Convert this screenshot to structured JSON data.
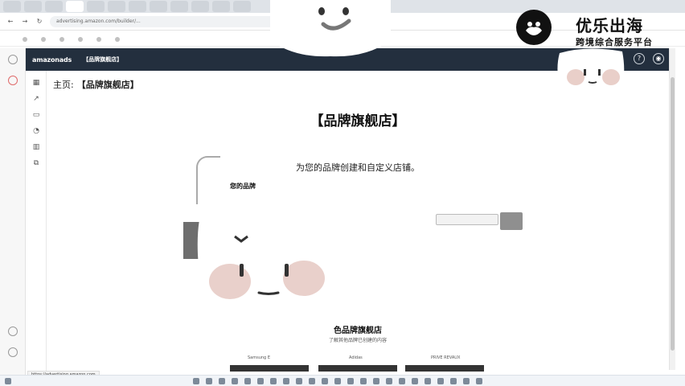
{
  "browser": {
    "tabs": [
      "",
      "",
      "",
      "",
      "",
      "",
      "",
      "",
      "",
      "",
      "",
      ""
    ],
    "url": "advertising.amazon.com/builder/...",
    "bookmarks": [
      "",
      "",
      "",
      "",
      "",
      "",
      ""
    ]
  },
  "leftrail": {
    "top_label": "",
    "bottom_label": ""
  },
  "ads_header": {
    "logo": "amazonads",
    "store_name": "【品牌旗舰店】",
    "help_icon": "?",
    "user_icon": "◉"
  },
  "breadcrumb": {
    "home": "主页:",
    "store": "【品牌旗舰店】"
  },
  "content": {
    "title": "【品牌旗舰店】",
    "subtitle": "为您的品牌创建和自定义店铺。",
    "brand_heading": "您的品牌",
    "brand_desc": "",
    "create_button": "",
    "manage_link": ""
  },
  "stores_section": {
    "heading": "色品牌旗舰店",
    "sub": "了解其他品牌已创建的内容",
    "cards": [
      "Samsung E",
      "Adidas",
      "PRIVE REVAUX"
    ]
  },
  "status_url": "https://advertising.amazon.com",
  "taskbar": {
    "time": ""
  },
  "watermark": {
    "title": "优乐出海",
    "subtitle": "跨境综合服务平台"
  },
  "colors": {
    "ads_header_bg": "#232f3e",
    "accent": "#232f3e"
  }
}
